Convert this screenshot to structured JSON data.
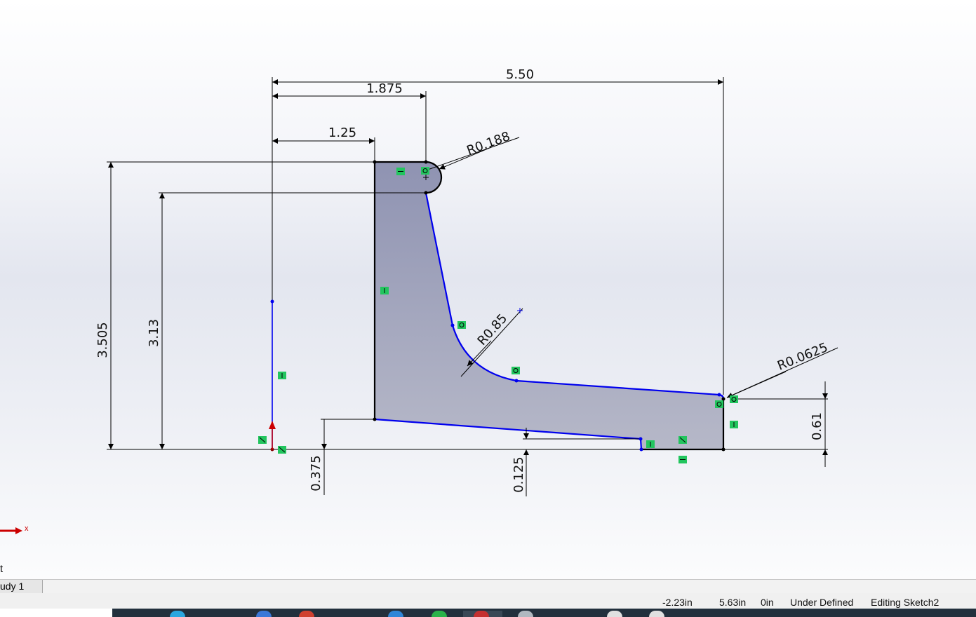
{
  "sketch": {
    "dimensions": {
      "overall_width": "5.50",
      "width_1875": "1.875",
      "width_125": "1.25",
      "radius_top": "R0.188",
      "radius_fillet": "R0.85",
      "radius_small": "R0.0625",
      "height_3505": "3.505",
      "height_313": "3.13",
      "height_0375": "0.375",
      "height_0125": "0.125",
      "height_061": "0.61"
    },
    "axis_x_label": "x"
  },
  "colors": {
    "profile_fill": "#a3a6bf",
    "under_defined": "#0000ff",
    "defined": "#000000",
    "relation_badge": "#22c55e",
    "origin_axis": "#cc0000"
  },
  "feature_tree": {
    "truncated_text": "t"
  },
  "tabs": [
    {
      "label": "udy 1"
    }
  ],
  "status": {
    "x_coord": "-2.23in",
    "y_coord": "5.63in",
    "z_coord": "0in",
    "state": "Under Defined",
    "mode": "Editing Sketch2"
  }
}
